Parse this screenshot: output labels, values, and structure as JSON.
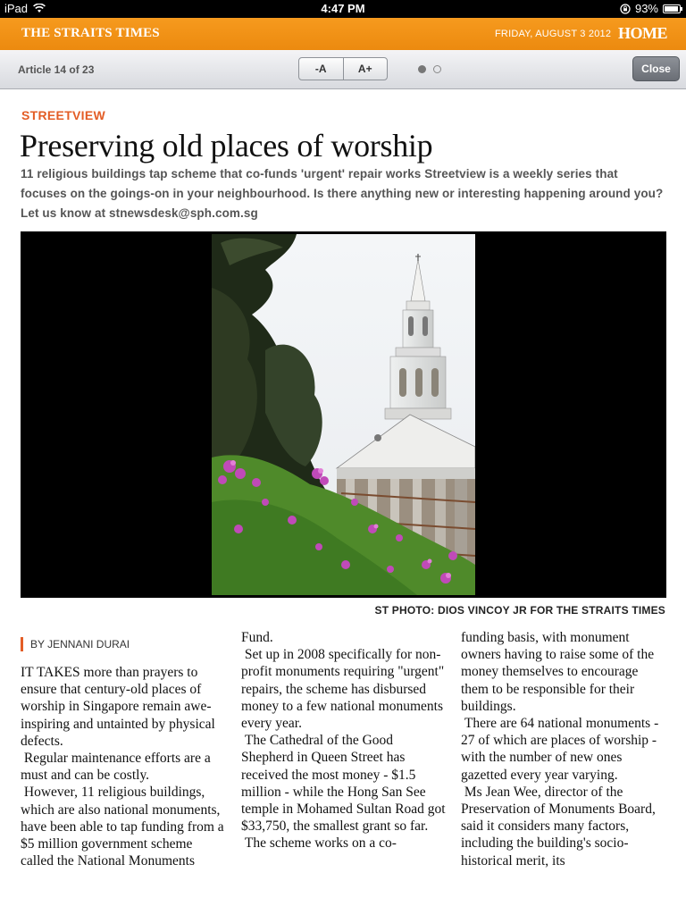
{
  "status_bar": {
    "device": "iPad",
    "time": "4:47 PM",
    "battery": "93%",
    "battery_level": 0.93
  },
  "masthead": {
    "brand": "THE STRAITS TIMES",
    "date": "FRIDAY, AUGUST 3 2012",
    "home_label": "HOME"
  },
  "toolbar": {
    "article_counter": "Article 14 of 23",
    "decrease_font": "-A",
    "increase_font": "A+",
    "close_label": "Close",
    "page_dots": [
      "active",
      "inactive"
    ]
  },
  "article": {
    "section": "STREETVIEW",
    "headline": "Preserving old places of worship",
    "standfirst": "11 religious buildings tap scheme that co-funds 'urgent' repair works Streetview is a weekly series that focuses on the goings-on in your neighbourhood. Is there anything new or interesting happening around you? Let us know at stnewsdesk@sph.com.sg",
    "photo_caption": "ST PHOTO: DIOS VINCOY JR FOR THE STRAITS TIMES",
    "byline": "BY JENNANI DURAI",
    "col1": [
      "IT TAKES more than prayers to ensure that century-old places of worship in Singapore remain awe-inspiring and untainted by physical defects.",
      " Regular maintenance efforts are a must and can be costly.",
      " However, 11 religious buildings, which are also national monuments, have been able to tap funding from a $5 million government scheme called the National Monuments"
    ],
    "col2": [
      "Fund.",
      " Set up in 2008 specifically for non-profit monuments requiring \"urgent\" repairs, the scheme has disbursed money to a few national monuments every year.",
      " The Cathedral of the Good Shepherd in Queen Street has received the most money - $1.5 million - while the Hong San See temple in Mohamed Sultan Road got $33,750, the smallest grant so far.",
      " The scheme works on a co-"
    ],
    "col3": [
      "funding basis, with monument owners having to raise some of the money themselves to encourage them to be responsible for their buildings.",
      " There are 64 national monuments - 27 of which are places of worship - with the number of new ones gazetted every year varying.",
      " Ms Jean Wee, director of the Preservation of Monuments Board, said it considers many factors, including the building's socio-historical merit, its"
    ]
  }
}
